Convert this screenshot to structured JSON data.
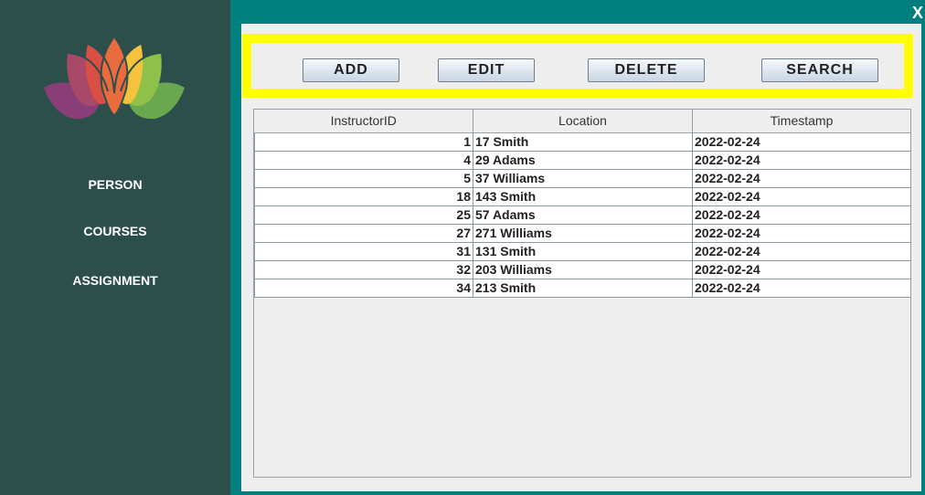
{
  "window": {
    "close_label": "X"
  },
  "sidebar": {
    "logo_icon": "lotus-logo-icon",
    "items": [
      {
        "label": "PERSON"
      },
      {
        "label": "COURSES"
      },
      {
        "label": "ASSIGNMENT"
      }
    ]
  },
  "toolbar": {
    "add_label": "ADD",
    "edit_label": "EDIT",
    "delete_label": "DELETE",
    "search_label": "SEARCH",
    "highlight_color": "#ffff00"
  },
  "table": {
    "headers": [
      "InstructorID",
      "Location",
      "Timestamp"
    ],
    "rows": [
      [
        "1",
        "17 Smith",
        "2022-02-24"
      ],
      [
        "4",
        "29 Adams",
        "2022-02-24"
      ],
      [
        "5",
        "37 Williams",
        "2022-02-24"
      ],
      [
        "18",
        "143 Smith",
        "2022-02-24"
      ],
      [
        "25",
        "57 Adams",
        "2022-02-24"
      ],
      [
        "27",
        "271 Williams",
        "2022-02-24"
      ],
      [
        "31",
        "131 Smith",
        "2022-02-24"
      ],
      [
        "32",
        "203 Williams",
        "2022-02-24"
      ],
      [
        "34",
        "213 Smith",
        "2022-02-24"
      ]
    ]
  },
  "colors": {
    "background": "#017f7f",
    "sidebar": "#2d4f4c",
    "panel": "#eeeeee"
  }
}
